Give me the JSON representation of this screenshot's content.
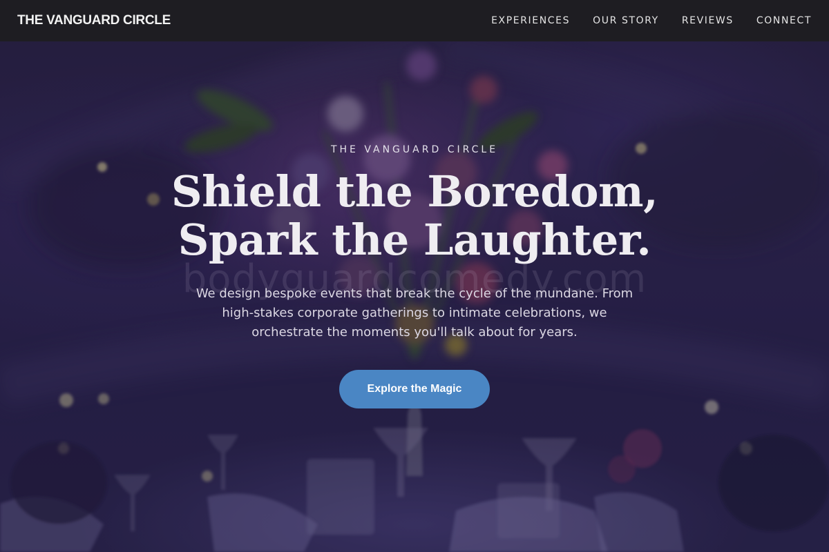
{
  "nav": {
    "brand": "THE VANGUARD CIRCLE",
    "links": [
      "EXPERIENCES",
      "OUR STORY",
      "REVIEWS",
      "CONNECT"
    ]
  },
  "hero": {
    "eyebrow": "THE VANGUARD CIRCLE",
    "headline_line1": "Shield the Boredom,",
    "headline_line2": "Spark the Laughter.",
    "watermark": "bodyguardcomedy.com",
    "description": "We design bespoke events that break the cycle of the mundane. From high-stakes corporate gatherings to intimate celebrations, we orchestrate the moments you'll talk about for years.",
    "cta_label": "Explore the Magic"
  },
  "colors": {
    "nav_background": "#1e1d22",
    "cta_background": "#4a86c4",
    "hero_tint": "#2d2650"
  },
  "background_image": "event-dinner-table-floral-centerpiece"
}
